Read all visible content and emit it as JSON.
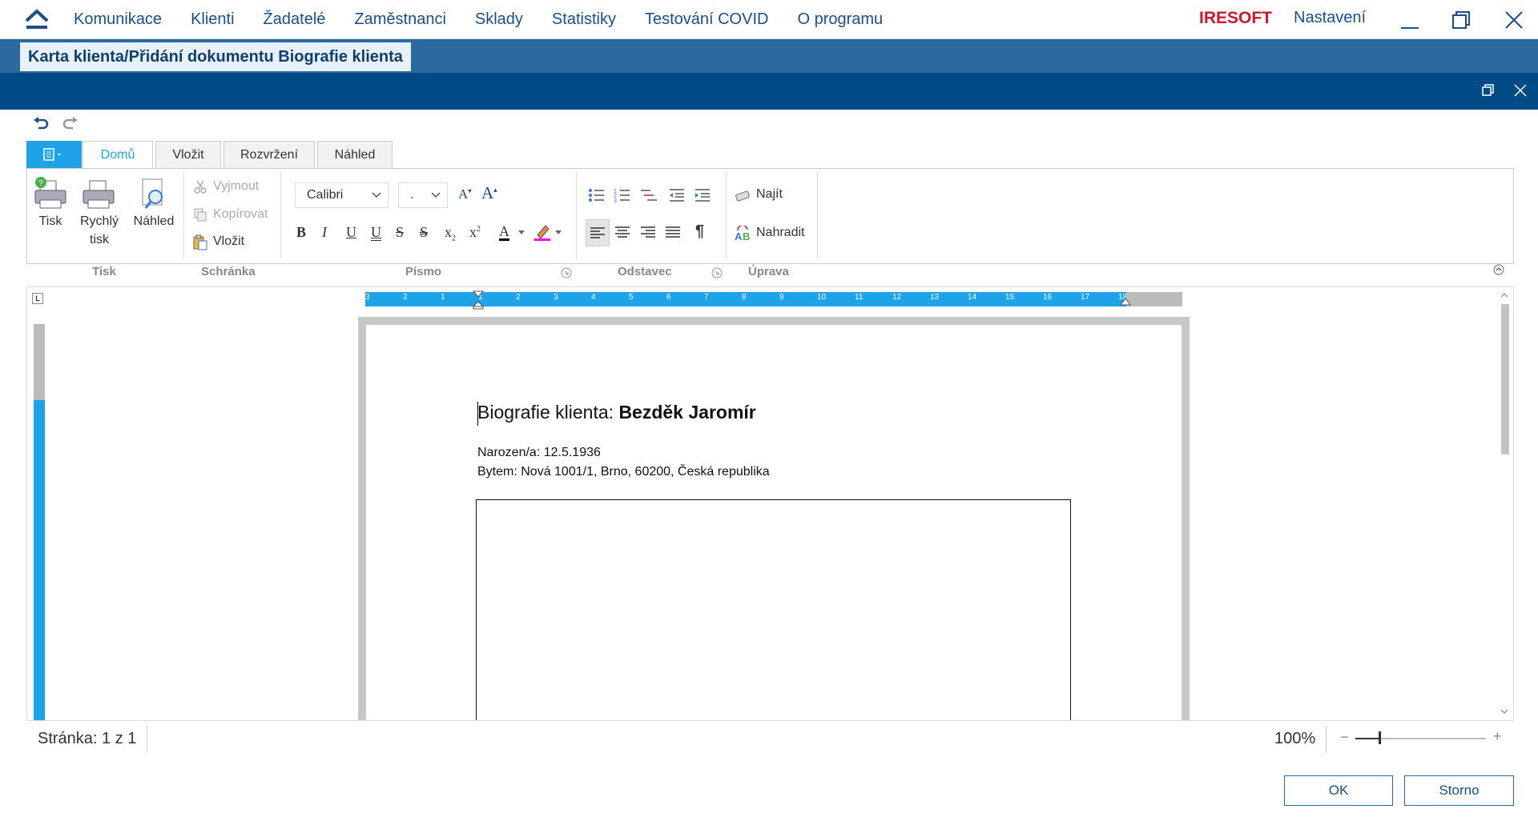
{
  "nav": {
    "items": [
      "Komunikace",
      "Klienti",
      "Žadatelé",
      "Zaměstnanci",
      "Sklady",
      "Statistiky",
      "Testování COVID",
      "O programu"
    ],
    "brand": "IRESOFT",
    "settings": "Nastavení"
  },
  "window": {
    "title": "Karta klienta/Přidání dokumentu Biografie klienta"
  },
  "ribbon": {
    "tabs": [
      "Domů",
      "Vložit",
      "Rozvržení",
      "Náhled"
    ],
    "active_tab": "Domů",
    "print": {
      "tisk": "Tisk",
      "rychly1": "Rychlý",
      "rychly2": "tisk",
      "nahled": "Náhled"
    },
    "clipboard": {
      "cut": "Vyjmout",
      "copy": "Kopírovat",
      "paste": "Vložit"
    },
    "font": {
      "family": "Calibri",
      "size": "."
    },
    "edit": {
      "find": "Najít",
      "replace": "Nahradit"
    },
    "groups": {
      "tisk": "Tisk",
      "schranka": "Schránka",
      "pismo": "Písmo",
      "odstavec": "Odstavec",
      "uprava": "Úprava"
    }
  },
  "ruler": {
    "ticks": [
      "3",
      "2",
      "1",
      "1",
      "2",
      "3",
      "4",
      "5",
      "6",
      "7",
      "8",
      "9",
      "10",
      "11",
      "12",
      "13",
      "14",
      "15",
      "16",
      "17",
      "18"
    ]
  },
  "document": {
    "title_prefix": "Biografie klienta: ",
    "title_name": "Bezděk Jaromír",
    "born": "Narozen/a: 12.5.1936",
    "address": "Bytem: Nová 1001/1, Brno, 60200, Česká republika"
  },
  "status": {
    "page": "Stránka: 1 z 1",
    "zoom": "100%",
    "zoom_level": 0.18
  },
  "buttons": {
    "ok": "OK",
    "cancel": "Storno"
  },
  "colors": {
    "brand": "#d0192a",
    "nav": "#1a4f8b",
    "header": "#004a85",
    "accent": "#1fa3e8"
  }
}
